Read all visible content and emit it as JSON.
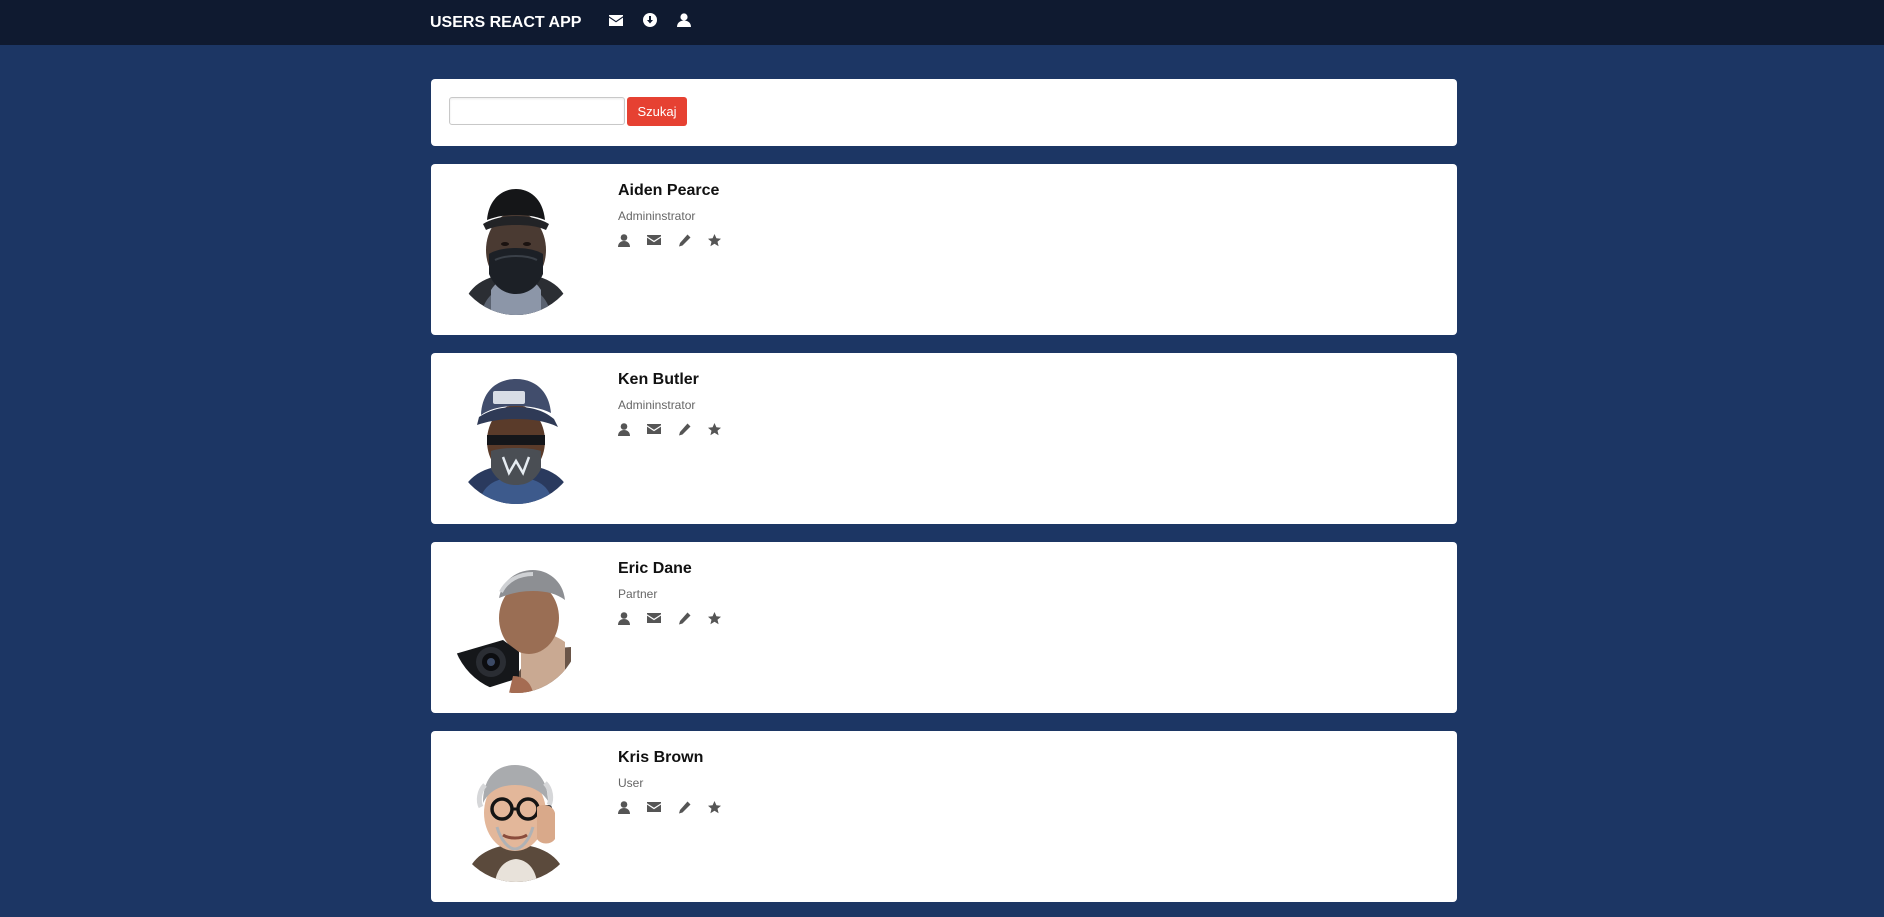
{
  "app": {
    "title": "USERS REACT APP"
  },
  "nav": {
    "icons": [
      "envelope-icon",
      "download-icon",
      "user-icon"
    ]
  },
  "search": {
    "value": "",
    "placeholder": "",
    "button_label": "Szukaj"
  },
  "users": [
    {
      "name": "Aiden Pearce",
      "role": "Admininstrator",
      "avatar": "masked-man-black-cap-avatar"
    },
    {
      "name": "Ken Butler",
      "role": "Admininstrator",
      "avatar": "masked-man-navy-cap-avatar"
    },
    {
      "name": "Eric Dane",
      "role": "Partner",
      "avatar": "grey-haired-man-camera-avatar"
    },
    {
      "name": "Kris Brown",
      "role": "User",
      "avatar": "man-glasses-phone-avatar"
    }
  ],
  "card_actions": [
    "user-icon",
    "envelope-icon",
    "pencil-icon",
    "star-icon"
  ],
  "colors": {
    "background": "#1c3664",
    "navbar": "#0f1a30",
    "accent_button": "#e64132",
    "panel": "#ffffff"
  }
}
